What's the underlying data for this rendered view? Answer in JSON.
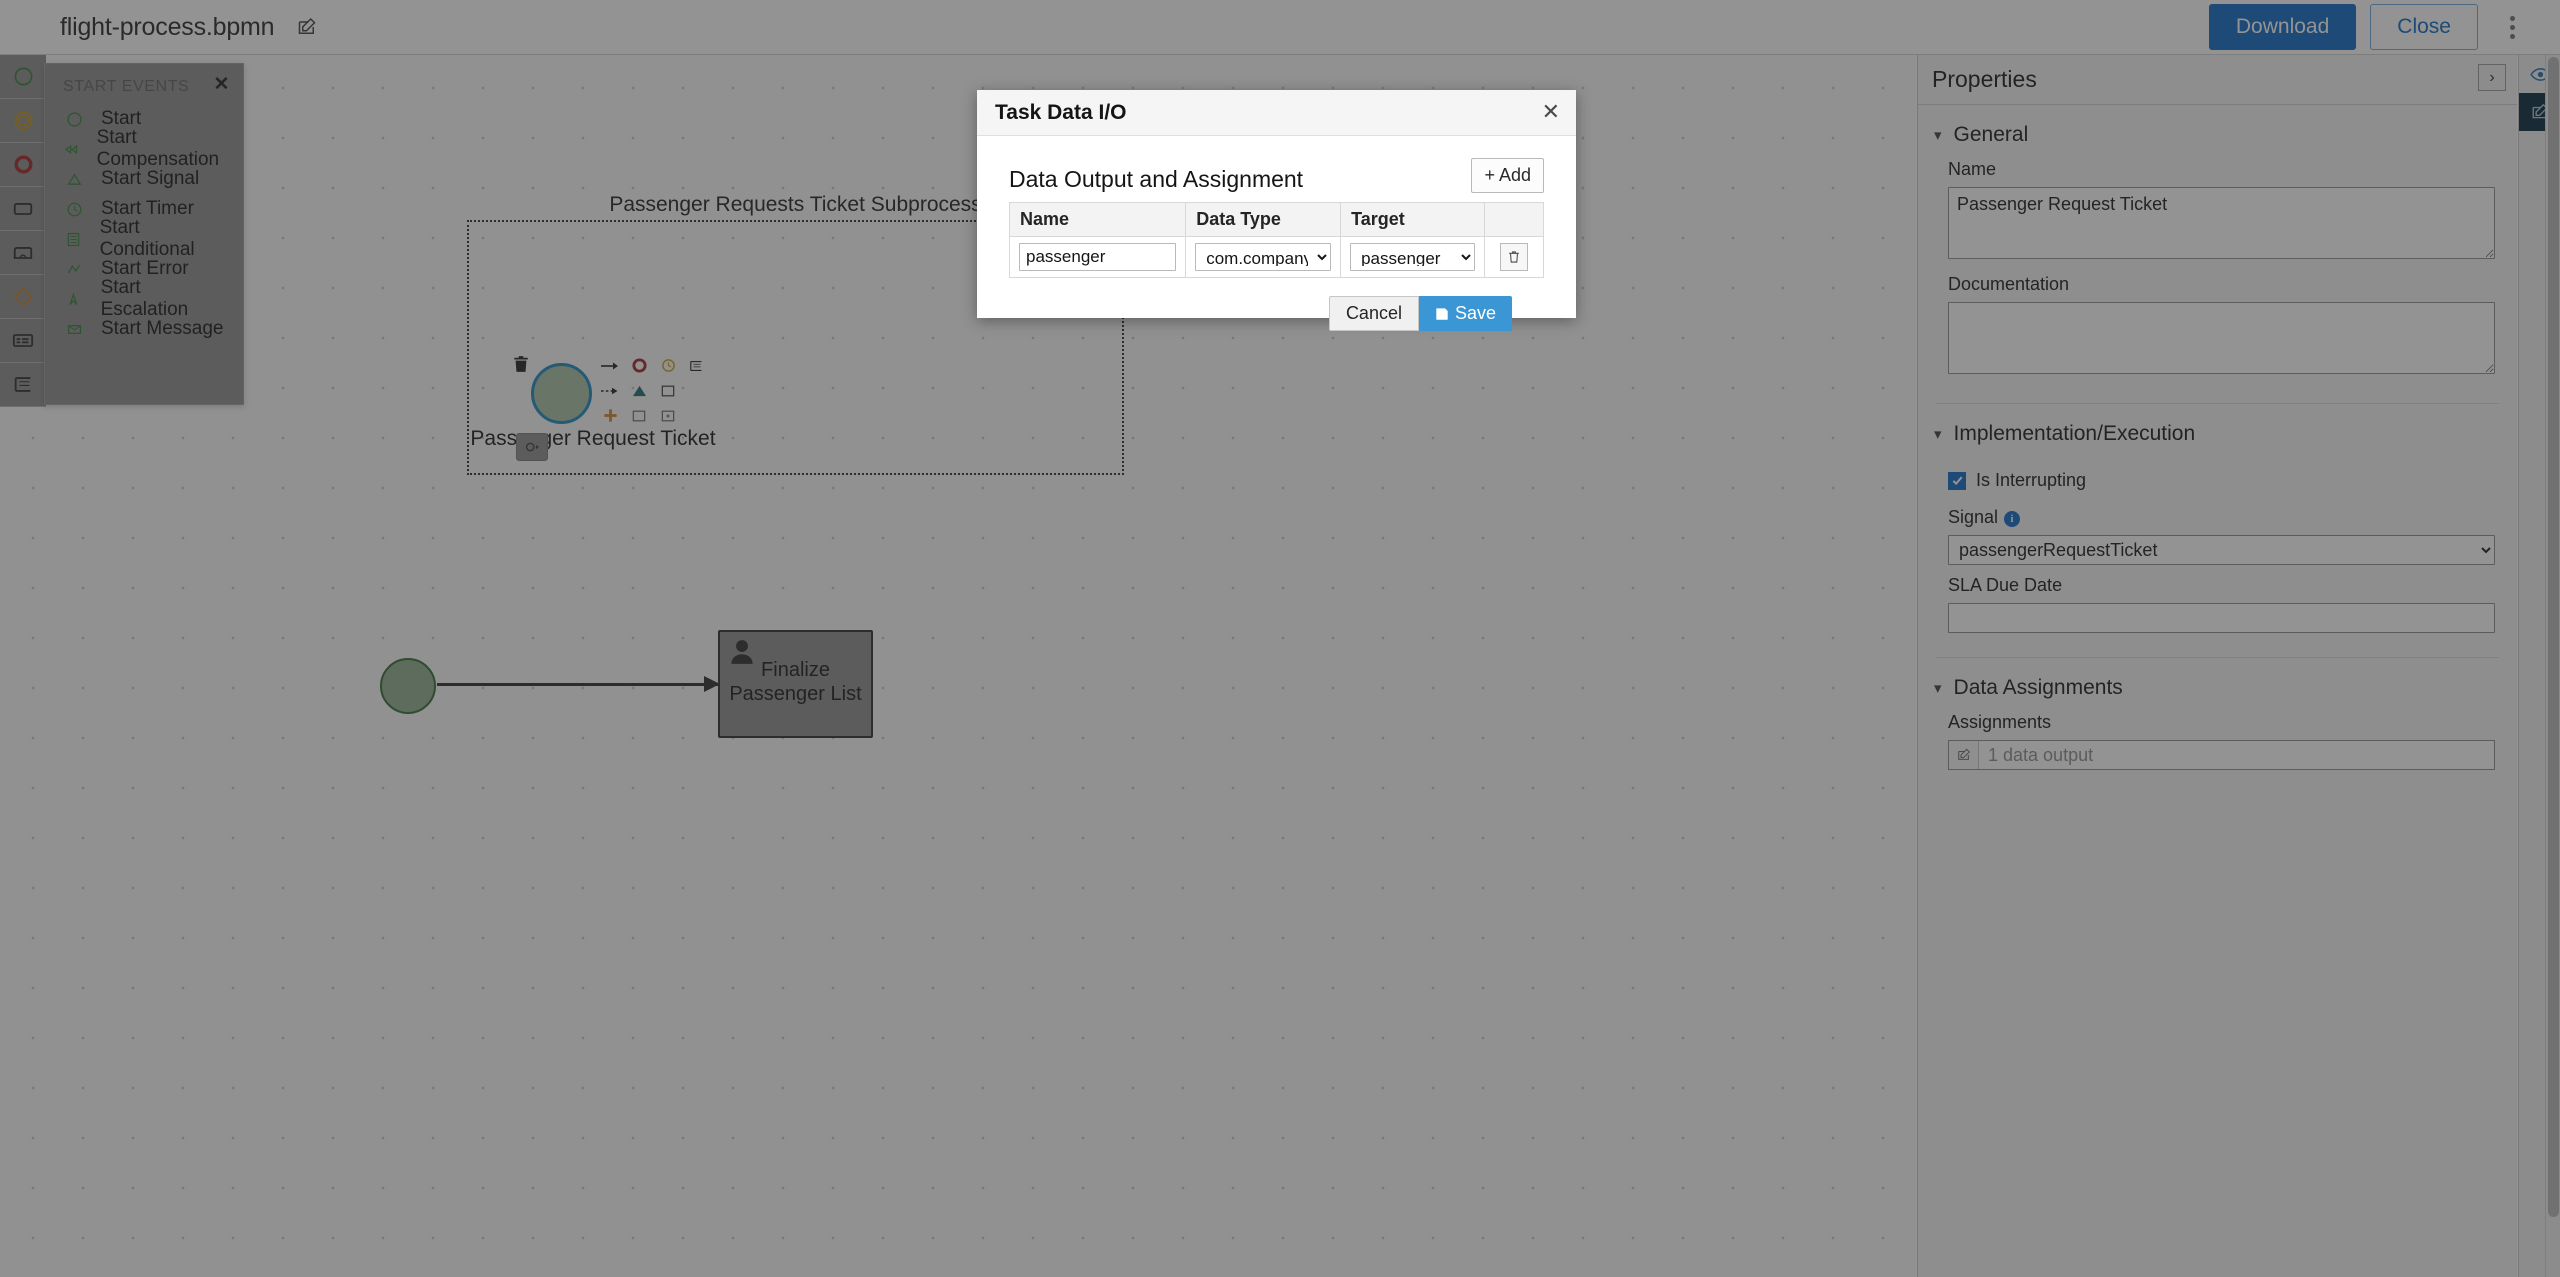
{
  "topbar": {
    "document_title": "flight-process.bpmn",
    "edit_icon": "edit-pencil-icon",
    "download_label": "Download",
    "close_label": "Close",
    "kebab_icon": "vertical-kebab-icon"
  },
  "palette": {
    "rail_items": [
      {
        "name": "start-events",
        "icon": "green-circle-icon"
      },
      {
        "name": "intermediate-events",
        "icon": "orange-double-circle-icon"
      },
      {
        "name": "end-events",
        "icon": "red-circle-icon"
      },
      {
        "name": "tasks",
        "icon": "rectangle-icon"
      },
      {
        "name": "subprocesses",
        "icon": "subprocess-icon"
      },
      {
        "name": "gateways",
        "icon": "orange-diamond-icon"
      },
      {
        "name": "containers",
        "icon": "container-icon"
      },
      {
        "name": "swimlanes",
        "icon": "swimlane-icon"
      }
    ],
    "flyout": {
      "title": "START EVENTS",
      "close_icon": "close-icon",
      "items": [
        {
          "label": "Start",
          "icon": "circle-icon"
        },
        {
          "label": "Start Compensation",
          "icon": "compensation-icon"
        },
        {
          "label": "Start Signal",
          "icon": "triangle-icon"
        },
        {
          "label": "Start Timer",
          "icon": "clock-icon"
        },
        {
          "label": "Start Conditional",
          "icon": "list-icon"
        },
        {
          "label": "Start Error",
          "icon": "error-bolt-icon"
        },
        {
          "label": "Start Escalation",
          "icon": "escalation-arrow-icon"
        },
        {
          "label": "Start Message",
          "icon": "envelope-icon"
        }
      ]
    }
  },
  "canvas": {
    "subprocess_label": "Passenger Requests Ticket Subprocess",
    "signal_event_label": "Passenger Request Ticket",
    "user_task_label": "Finalize Passenger List",
    "context_toolbar": [
      "sequence-flow-icon",
      "end-event-icon",
      "timer-event-icon",
      "swimlane-icon",
      "association-flow-icon",
      "signal-triangle-icon",
      "task-icon",
      "add-icon",
      "subprocess-icon",
      "expand-subprocess-icon"
    ],
    "delete_icon": "trash-icon",
    "gear_icon": "gear-icon"
  },
  "modal": {
    "title": "Task Data I/O",
    "close_icon": "close-icon",
    "section_title": "Data Output and Assignment",
    "add_label": "+ Add",
    "columns": [
      "Name",
      "Data Type",
      "Target"
    ],
    "rows": [
      {
        "name": "passenger",
        "data_type": "com.company.Pass",
        "target": "passenger",
        "delete_icon": "trash-icon"
      }
    ],
    "cancel_label": "Cancel",
    "save_label": "Save",
    "save_icon": "floppy-disk-icon"
  },
  "properties": {
    "title": "Properties",
    "collapse_icon": "chevron-right-icon",
    "sections": {
      "general": {
        "label": "General",
        "name_label": "Name",
        "name_value": "Passenger Request Ticket",
        "documentation_label": "Documentation",
        "documentation_value": ""
      },
      "implementation": {
        "label": "Implementation/Execution",
        "is_interrupting_label": "Is Interrupting",
        "is_interrupting_checked": true,
        "signal_label": "Signal",
        "signal_info_icon": "info-icon",
        "signal_value": "passengerRequestTicket",
        "sla_label": "SLA Due Date",
        "sla_value": ""
      },
      "data_assignments": {
        "label": "Data Assignments",
        "assignments_label": "Assignments",
        "assignments_value": "1 data output",
        "edit_icon": "edit-pencil-icon"
      }
    },
    "rail": {
      "preview_icon": "eye-icon",
      "edit_icon": "edit-pencil-icon"
    }
  },
  "colors": {
    "primary_blue": "#0a66c2",
    "save_blue": "#3a96d4",
    "selection_blue": "#1b89c4",
    "start_green": "#2f6b2f",
    "end_red": "#a42020",
    "gateway_orange": "#c77c23"
  }
}
